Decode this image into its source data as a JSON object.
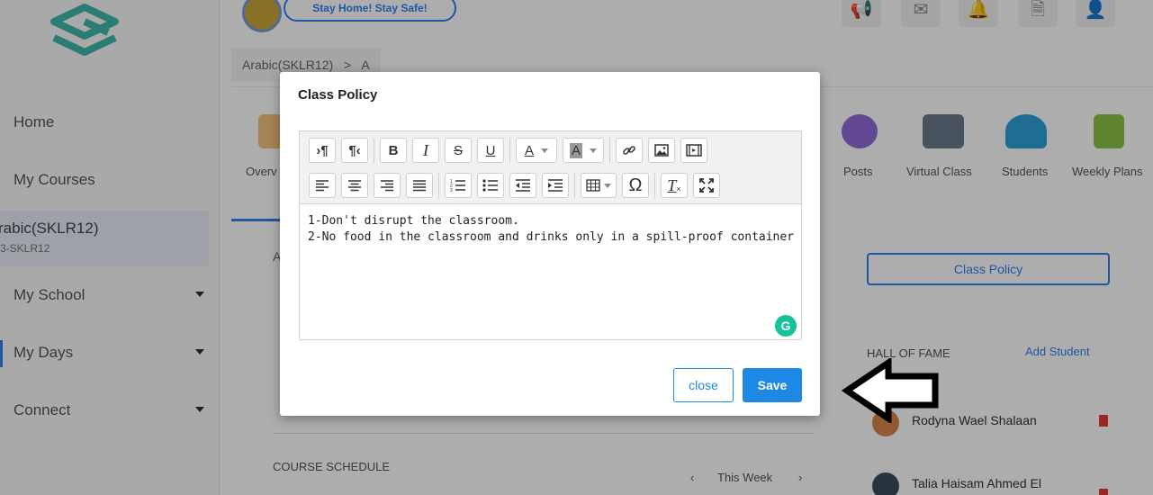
{
  "sidebar": {
    "items": [
      {
        "label": "Home"
      },
      {
        "label": "My Courses"
      },
      {
        "label": "My School"
      },
      {
        "label": "My Days"
      },
      {
        "label": "Connect"
      }
    ],
    "current_course": {
      "title": "rabic(SKLR12)",
      "code": "3-SKLR12"
    }
  },
  "topbar": {
    "banner": "Stay Home! Stay Safe!",
    "icons": [
      "megaphone-icon",
      "mail-icon",
      "bell-icon",
      "document-icon",
      "user-avatar-icon"
    ]
  },
  "breadcrumb": {
    "course": "Arabic(SKLR12)",
    "separator": ">",
    "section": "A"
  },
  "tabs": [
    {
      "label": "Overv",
      "icon": "overview-icon"
    },
    {
      "label": "Posts",
      "icon": "posts-icon"
    },
    {
      "label": "Virtual Class",
      "icon": "virtual-class-icon"
    },
    {
      "label": "Students",
      "icon": "students-icon"
    },
    {
      "label": "Weekly Plans",
      "icon": "weekly-plans-icon"
    }
  ],
  "right_panel": {
    "class_policy_button": "Class Policy",
    "hall_of_fame": "HALL OF FAME",
    "add_student": "Add Student",
    "students": [
      "Rodyna Wael Shalaan",
      "Talia Haisam Ahmed El"
    ]
  },
  "main_panel": {
    "section_letter": "A",
    "course_schedule": "COURSE SCHEDULE",
    "week_label": "This Week",
    "prev_arrow": "‹",
    "next_arrow": "›"
  },
  "modal": {
    "title": "Class Policy",
    "editor_lines": [
      "1-Don't disrupt the classroom.",
      "2-No food in the classroom and drinks only in a spill-proof container"
    ],
    "close_label": "close",
    "save_label": "Save",
    "toolbar_row1": [
      {
        "name": "paragraph-ltr-icon",
        "glyph": "¶"
      },
      {
        "name": "paragraph-rtl-icon",
        "glyph": "¶"
      },
      {
        "name": "bold-icon",
        "glyph": "B"
      },
      {
        "name": "italic-icon",
        "glyph": "I"
      },
      {
        "name": "strikethrough-icon",
        "glyph": "S"
      },
      {
        "name": "underline-icon",
        "glyph": "U"
      },
      {
        "name": "font-color-icon",
        "glyph": "A"
      },
      {
        "name": "background-color-icon",
        "glyph": "A"
      },
      {
        "name": "link-icon",
        "glyph": "🔗"
      },
      {
        "name": "image-icon",
        "glyph": "▣"
      },
      {
        "name": "video-icon",
        "glyph": "▤"
      }
    ],
    "toolbar_row2": [
      {
        "name": "align-left-icon"
      },
      {
        "name": "align-center-icon"
      },
      {
        "name": "align-right-icon"
      },
      {
        "name": "align-justify-icon"
      },
      {
        "name": "ordered-list-icon"
      },
      {
        "name": "unordered-list-icon"
      },
      {
        "name": "outdent-icon"
      },
      {
        "name": "indent-icon"
      },
      {
        "name": "table-icon"
      },
      {
        "name": "special-character-icon",
        "glyph": "Ω"
      },
      {
        "name": "clear-formatting-icon",
        "glyph": "T"
      },
      {
        "name": "fullscreen-icon"
      }
    ]
  },
  "colors": {
    "accent": "#1e88e5",
    "grammarly": "#15c39a",
    "overlay": "rgba(0,0,0,0.32)"
  }
}
